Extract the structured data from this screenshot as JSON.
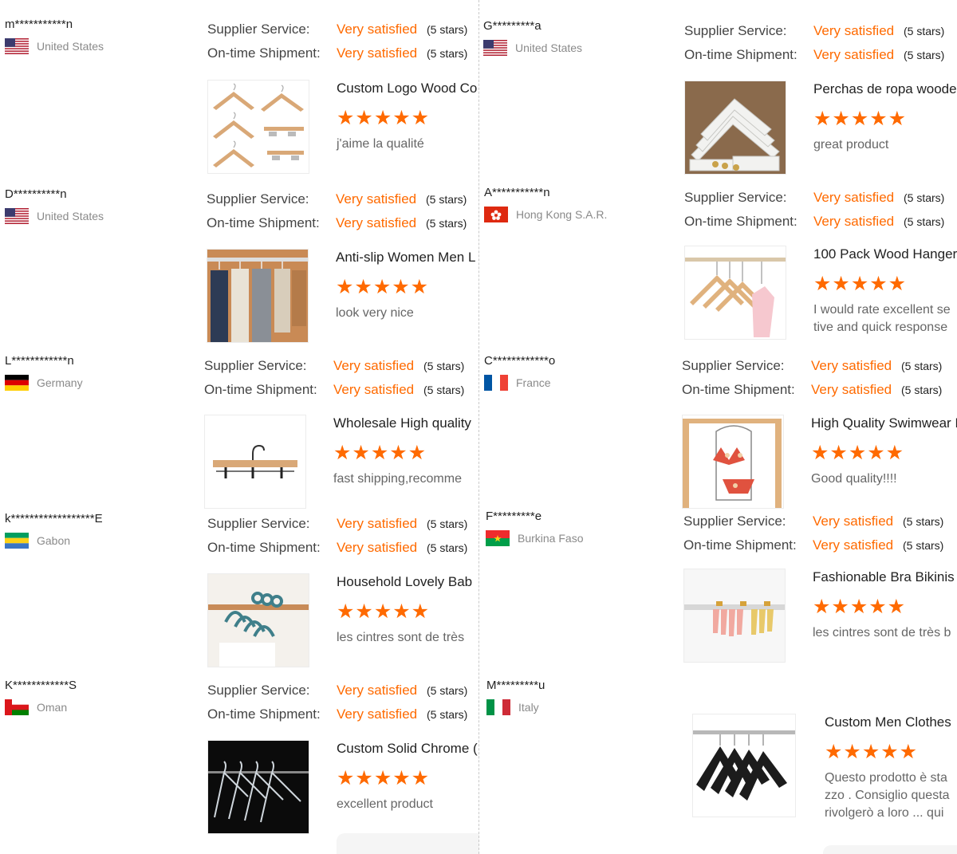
{
  "left_column": [
    {
      "buyer_name": "m***********n",
      "country": "United States",
      "flag": "us",
      "ratings": [
        {
          "label": "Supplier Service:",
          "value": "Very satisfied",
          "stars": "(5 stars)"
        },
        {
          "label": "On-time Shipment:",
          "value": "Very satisfied",
          "stars": "(5 stars)"
        }
      ],
      "product_title": "Custom Logo Wood Co",
      "rating_stars": "★★★★★",
      "rating": 5,
      "comment": "j'aime la qualité",
      "image": "wood-hangers-icon"
    },
    {
      "buyer_name": "D**********n",
      "country": "United States",
      "flag": "us",
      "ratings": [
        {
          "label": "Supplier Service:",
          "value": "Very satisfied",
          "stars": "(5 stars)"
        },
        {
          "label": "On-time Shipment:",
          "value": "Very satisfied",
          "stars": "(5 stars)"
        }
      ],
      "product_title": "Anti-slip Women Men L",
      "rating_stars": "★★★★★",
      "rating": 5,
      "comment": "look very nice",
      "image": "closet-clothes-icon"
    },
    {
      "buyer_name": "L************n",
      "country": "Germany",
      "flag": "de",
      "ratings": [
        {
          "label": "Supplier Service:",
          "value": "Very satisfied",
          "stars": "(5 stars)"
        },
        {
          "label": "On-time Shipment:",
          "value": "Very satisfied",
          "stars": "(5 stars)"
        }
      ],
      "product_title": "Wholesale High quality",
      "rating_stars": "★★★★★",
      "rating": 5,
      "comment": "fast shipping,recomme",
      "image": "pants-hanger-icon"
    },
    {
      "buyer_name": "k******************E",
      "country": "Gabon",
      "flag": "ga",
      "ratings": [
        {
          "label": "Supplier Service:",
          "value": "Very satisfied",
          "stars": "(5 stars)"
        },
        {
          "label": "On-time Shipment:",
          "value": "Very satisfied",
          "stars": "(5 stars)"
        }
      ],
      "product_title": "Household Lovely Bab",
      "rating_stars": "★★★★★",
      "rating": 5,
      "comment": "les cintres sont de très",
      "image": "baby-hangers-icon"
    },
    {
      "buyer_name": "K************S",
      "country": "Oman",
      "flag": "om",
      "ratings": [
        {
          "label": "Supplier Service:",
          "value": "Very satisfied",
          "stars": "(5 stars)"
        },
        {
          "label": "On-time Shipment:",
          "value": "Very satisfied",
          "stars": "(5 stars)"
        }
      ],
      "product_title": "Custom Solid Chrome (",
      "rating_stars": "★★★★★",
      "rating": 5,
      "comment": "excellent product",
      "image": "acrylic-hangers-icon"
    }
  ],
  "right_column": [
    {
      "buyer_name": "G*********a",
      "country": "United States",
      "flag": "us",
      "ratings": [
        {
          "label": "Supplier Service:",
          "value": "Very satisfied",
          "stars": "(5 stars)"
        },
        {
          "label": "On-time Shipment:",
          "value": "Very satisfied",
          "stars": "(5 stars)"
        }
      ],
      "product_title": "Perchas de ropa woode",
      "rating_stars": "★★★★★",
      "rating": 5,
      "comment": "great product",
      "image": "white-hangers-stack-icon"
    },
    {
      "buyer_name": "A***********n",
      "country": "Hong Kong S.A.R.",
      "flag": "hk",
      "ratings": [
        {
          "label": "Supplier Service:",
          "value": "Very satisfied",
          "stars": "(5 stars)"
        },
        {
          "label": "On-time Shipment:",
          "value": "Very satisfied",
          "stars": "(5 stars)"
        }
      ],
      "product_title": "100 Pack Wood Hanger",
      "rating_stars": "★★★★★",
      "rating": 5,
      "comment": "I would rate excellent se tive and quick response",
      "image": "wood-hangers-rail-icon"
    },
    {
      "buyer_name": "C************o",
      "country": "France",
      "flag": "fr",
      "ratings": [
        {
          "label": "Supplier Service:",
          "value": "Very satisfied",
          "stars": "(5 stars)"
        },
        {
          "label": "On-time Shipment:",
          "value": "Very satisfied",
          "stars": "(5 stars)"
        }
      ],
      "product_title": "High Quality Swimwear H",
      "rating_stars": "★★★★★",
      "rating": 5,
      "comment": "Good quality!!!!",
      "image": "swimwear-hanger-icon"
    },
    {
      "buyer_name": "F*********e",
      "country": "Burkina Faso",
      "flag": "bf",
      "ratings": [
        {
          "label": "Supplier Service:",
          "value": "Very satisfied",
          "stars": "(5 stars)"
        },
        {
          "label": "On-time Shipment:",
          "value": "Very satisfied",
          "stars": "(5 stars)"
        }
      ],
      "product_title": "Fashionable Bra Bikinis",
      "rating_stars": "★★★★★",
      "rating": 5,
      "comment": "les cintres sont de très b",
      "image": "bikini-hangers-icon"
    },
    {
      "buyer_name": "M*********u",
      "country": "Italy",
      "flag": "it",
      "ratings": [],
      "product_title": "Custom Men Clothes",
      "rating_stars": "★★★★★",
      "rating": 5,
      "comment": "Questo prodotto è sta zzo . Consiglio questa rivolgerò a loro ... qui",
      "image": "black-hangers-icon"
    }
  ],
  "colors": {
    "accent": "#ff6a00",
    "label": "#444444",
    "muted": "#8a8a8a",
    "divider": "#c9c9c9"
  }
}
